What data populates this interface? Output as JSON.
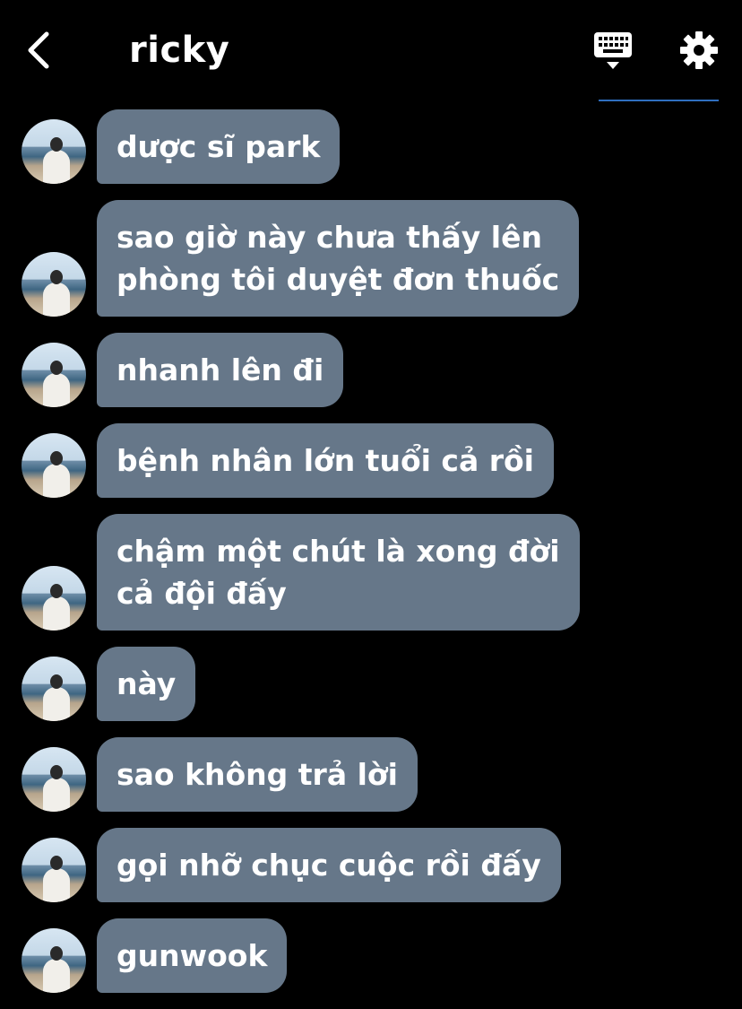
{
  "header": {
    "title": "ricky",
    "back_icon": "chevron-left-icon",
    "keyboard_icon": "keyboard-icon",
    "settings_icon": "gear-icon"
  },
  "colors": {
    "background": "#000000",
    "bubble": "#667789",
    "text": "#ffffff",
    "accent": "#2f6fbf"
  },
  "messages": [
    {
      "lines": [
        "dược sĩ park"
      ]
    },
    {
      "lines": [
        "sao giờ này chưa thấy lên",
        "phòng tôi duyệt đơn thuốc"
      ]
    },
    {
      "lines": [
        "nhanh lên đi"
      ]
    },
    {
      "lines": [
        "bệnh nhân lớn tuổi cả rồi"
      ]
    },
    {
      "lines": [
        "chậm một chút là xong đời",
        "cả đội đấy"
      ]
    },
    {
      "lines": [
        "này"
      ]
    },
    {
      "lines": [
        "sao không trả lời"
      ]
    },
    {
      "lines": [
        "gọi nhỡ chục cuộc rồi đấy"
      ]
    },
    {
      "lines": [
        "gunwook"
      ]
    }
  ]
}
